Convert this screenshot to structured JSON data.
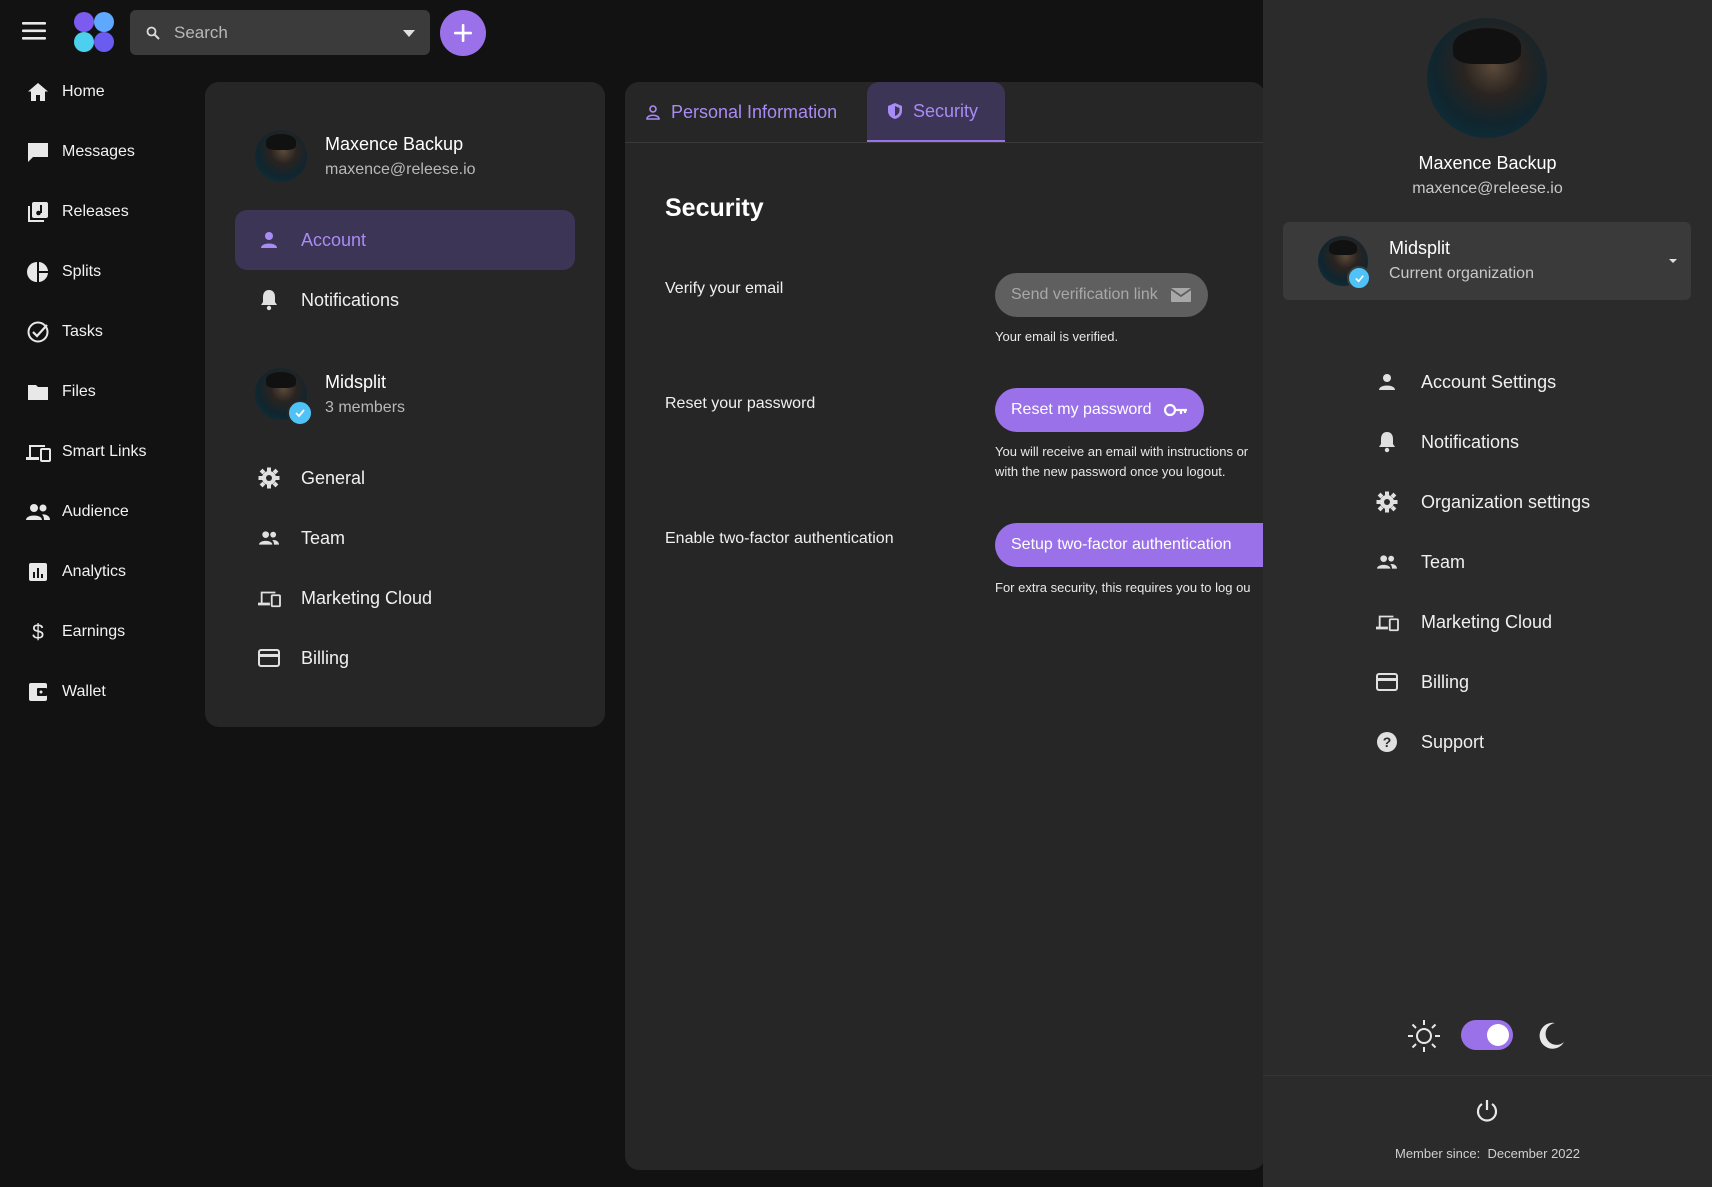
{
  "topbar": {
    "search_placeholder": "Search"
  },
  "nav": {
    "items": [
      {
        "label": "Home",
        "icon": "home-icon"
      },
      {
        "label": "Messages",
        "icon": "message-icon"
      },
      {
        "label": "Releases",
        "icon": "music-library-icon"
      },
      {
        "label": "Splits",
        "icon": "pie-chart-icon"
      },
      {
        "label": "Tasks",
        "icon": "check-circle-icon"
      },
      {
        "label": "Files",
        "icon": "folder-icon"
      },
      {
        "label": "Smart Links",
        "icon": "devices-icon"
      },
      {
        "label": "Audience",
        "icon": "people-icon"
      },
      {
        "label": "Analytics",
        "icon": "bar-chart-icon"
      },
      {
        "label": "Earnings",
        "icon": "dollar-icon"
      },
      {
        "label": "Wallet",
        "icon": "wallet-icon"
      }
    ]
  },
  "settings_panel": {
    "user": {
      "name": "Maxence Backup",
      "email": "maxence@releese.io"
    },
    "account_items": [
      {
        "label": "Account",
        "icon": "person-icon",
        "active": true
      },
      {
        "label": "Notifications",
        "icon": "bell-icon",
        "active": false
      }
    ],
    "org": {
      "name": "Midsplit",
      "members": "3 members"
    },
    "org_items": [
      {
        "label": "General",
        "icon": "gear-icon"
      },
      {
        "label": "Team",
        "icon": "people-icon"
      },
      {
        "label": "Marketing Cloud",
        "icon": "devices-icon"
      },
      {
        "label": "Billing",
        "icon": "credit-card-icon"
      }
    ]
  },
  "main": {
    "tabs": [
      {
        "label": "Personal Information",
        "icon": "person-outline-icon",
        "active": false
      },
      {
        "label": "Security",
        "icon": "shield-icon",
        "active": true
      }
    ],
    "title": "Security",
    "verify": {
      "label": "Verify your email",
      "button": "Send verification link",
      "help": "Your email is verified."
    },
    "reset": {
      "label": "Reset your password",
      "button": "Reset my password",
      "help_line1": "You will receive an email with instructions or",
      "help_line2": "with the new password once you logout."
    },
    "twofa": {
      "label": "Enable two-factor authentication",
      "button": "Setup two-factor authentication",
      "help": "For extra security, this requires you to log ou"
    }
  },
  "drawer": {
    "user": {
      "name": "Maxence Backup",
      "email": "maxence@releese.io"
    },
    "org": {
      "name": "Midsplit",
      "caption": "Current organization"
    },
    "items": [
      {
        "label": "Account Settings",
        "icon": "person-icon"
      },
      {
        "label": "Notifications",
        "icon": "bell-icon"
      },
      {
        "label": "Organization settings",
        "icon": "gear-icon"
      },
      {
        "label": "Team",
        "icon": "people-icon"
      },
      {
        "label": "Marketing Cloud",
        "icon": "devices-icon"
      },
      {
        "label": "Billing",
        "icon": "credit-card-icon"
      },
      {
        "label": "Support",
        "icon": "help-circle-icon"
      }
    ],
    "dark_mode": true,
    "member_since_label": "Member since:",
    "member_since_value": "December 2022"
  },
  "colors": {
    "accent": "#9b71ea",
    "accent_text": "#a98bf5",
    "background": "#121212",
    "panel": "#262626",
    "drawer": "#2b2b2b",
    "verified": "#4fc3f7"
  }
}
